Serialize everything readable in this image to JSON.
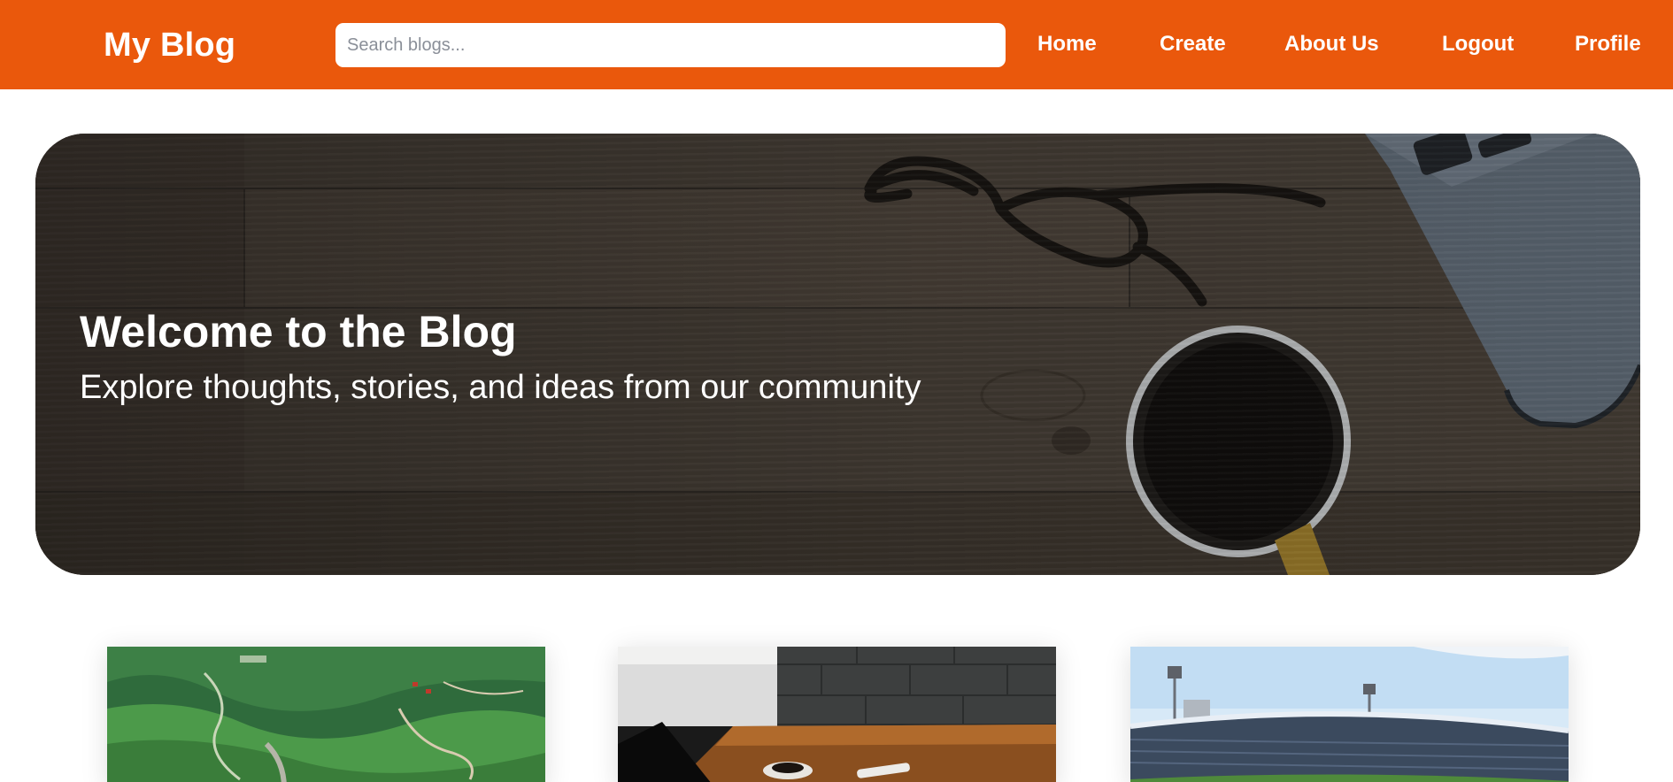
{
  "navbar": {
    "brand": "My Blog",
    "search_placeholder": "Search blogs...",
    "links": [
      "Home",
      "Create",
      "About Us",
      "Logout",
      "Profile"
    ]
  },
  "hero": {
    "title": "Welcome to the Blog",
    "subtitle": "Explore thoughts, stories, and ideas from our community"
  },
  "colors": {
    "accent": "#ea580c"
  }
}
